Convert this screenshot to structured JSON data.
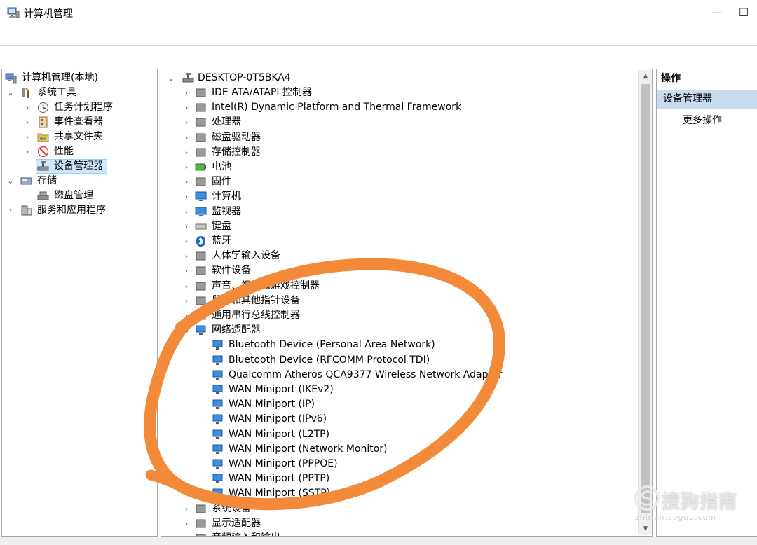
{
  "window": {
    "title": "计算机管理",
    "minimize_glyph": "—",
    "maximize_glyph": "☐"
  },
  "left_tree": {
    "root": "计算机管理(本地)",
    "items": [
      {
        "label": "系统工具",
        "icon": "tools-icon",
        "arrow": "⌄"
      },
      {
        "label": "任务计划程序",
        "icon": "clock-icon",
        "arrow": "›"
      },
      {
        "label": "事件查看器",
        "icon": "event-viewer-icon",
        "arrow": "›"
      },
      {
        "label": "共享文件夹",
        "icon": "shared-folder-icon",
        "arrow": "›"
      },
      {
        "label": "性能",
        "icon": "performance-icon",
        "arrow": "›"
      },
      {
        "label": "设备管理器",
        "icon": "device-manager-icon",
        "arrow": ""
      },
      {
        "label": "存储",
        "icon": "storage-icon",
        "arrow": "⌄"
      },
      {
        "label": "磁盘管理",
        "icon": "disk-management-icon",
        "arrow": ""
      },
      {
        "label": "服务和应用程序",
        "icon": "services-icon",
        "arrow": "›"
      }
    ]
  },
  "device_tree": {
    "root": "DESKTOP-0T5BKA4",
    "categories": [
      "IDE ATA/ATAPI 控制器",
      "Intel(R) Dynamic Platform and Thermal Framework",
      "处理器",
      "磁盘驱动器",
      "存储控制器",
      "电池",
      "固件",
      "计算机",
      "监视器",
      "键盘",
      "蓝牙",
      "人体学输入设备",
      "软件设备",
      "声音、视频和游戏控制器",
      "鼠标和其他指针设备",
      "通用串行总线控制器",
      "网络适配器"
    ],
    "network_adapters": [
      "Bluetooth Device (Personal Area Network)",
      "Bluetooth Device (RFCOMM Protocol TDI)",
      "Qualcomm Atheros QCA9377 Wireless Network Adapter",
      "WAN Miniport (IKEv2)",
      "WAN Miniport (IP)",
      "WAN Miniport (IPv6)",
      "WAN Miniport (L2TP)",
      "WAN Miniport (Network Monitor)",
      "WAN Miniport (PPPOE)",
      "WAN Miniport (PPTP)",
      "WAN Miniport (SSTP)"
    ],
    "after_categories": [
      "系统设备",
      "显示适配器",
      "音频输入和输出"
    ]
  },
  "actions": {
    "header": "操作",
    "selected": "设备管理器",
    "more": "更多操作"
  },
  "watermark": {
    "text": "搜狗指南",
    "url": "zhinan.sogou.com"
  },
  "colors": {
    "annotation": "#f28a3a",
    "selection": "#cce8ff",
    "action_selected": "#c9dcef"
  }
}
